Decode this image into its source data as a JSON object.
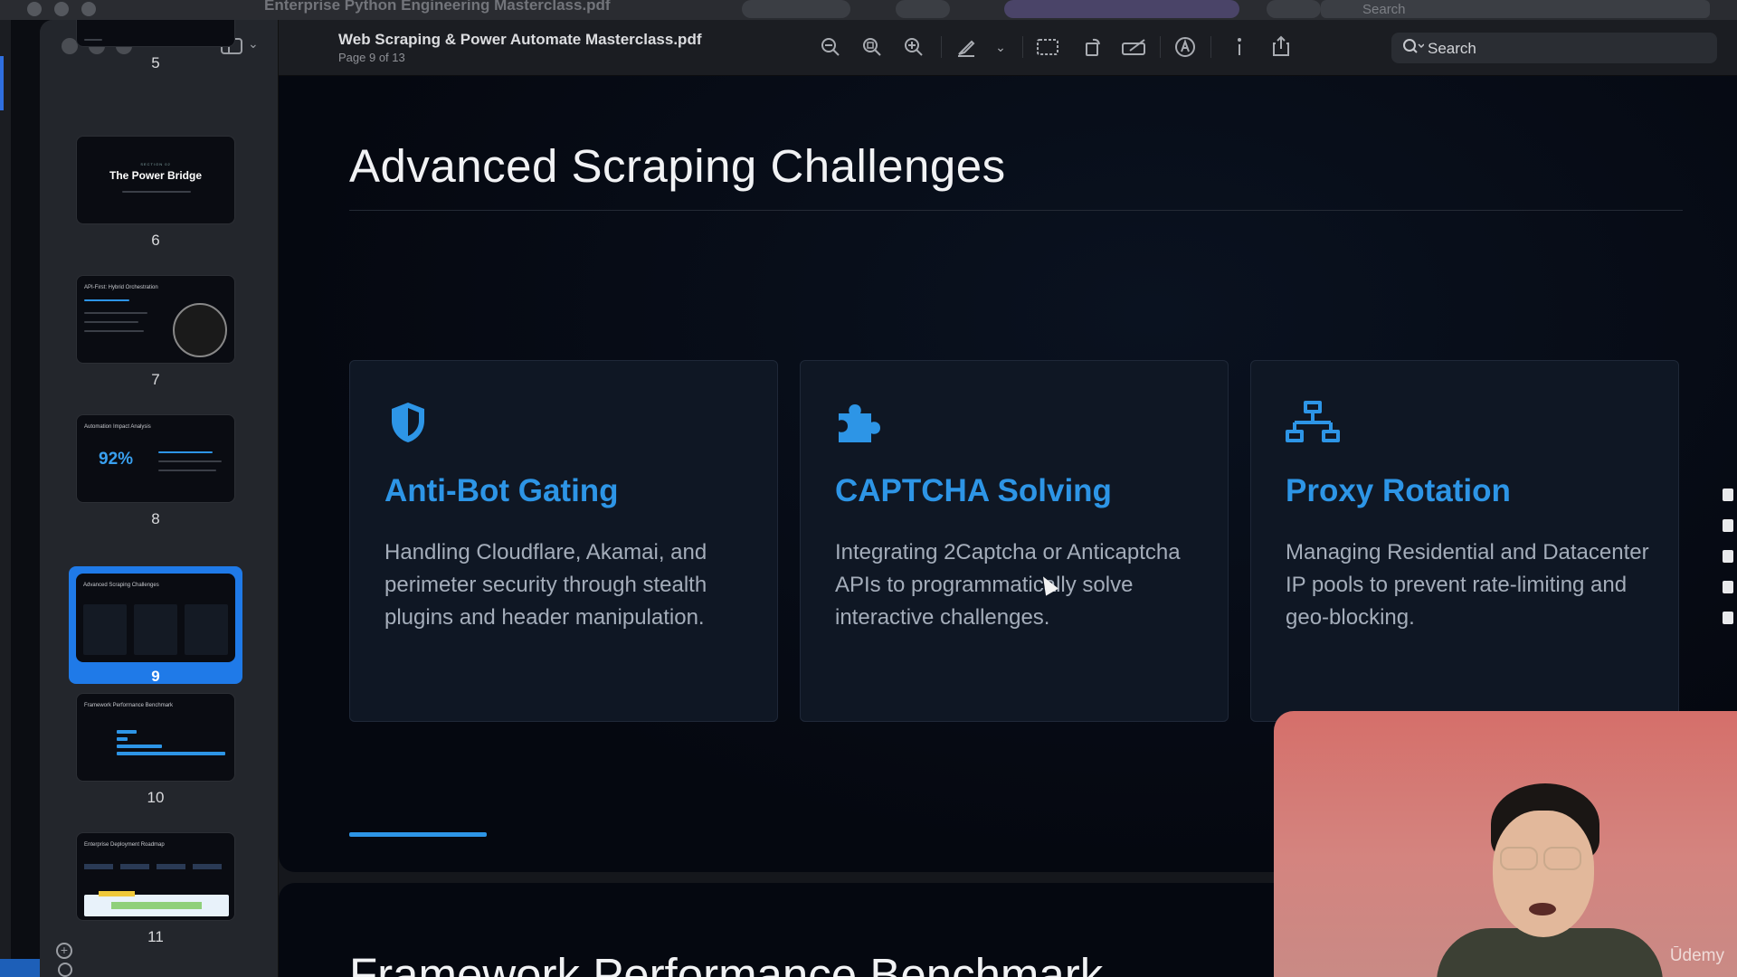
{
  "background_window": {
    "title": "Enterprise Python Engineering Masterclass.pdf",
    "search_placeholder": "Search"
  },
  "window": {
    "document_title": "Web Scraping & Power Automate Masterclass.pdf",
    "page_indicator": "Page 9 of 13",
    "search_label": "Search"
  },
  "toolbar": {
    "icons": [
      "zoom-out-icon",
      "zoom-fit-icon",
      "zoom-in-icon",
      "highlighter-icon",
      "chevron-down-icon",
      "image-select-icon",
      "rotate-icon",
      "markup-icon",
      "accessibility-icon",
      "info-icon",
      "share-icon",
      "search-icon"
    ]
  },
  "sidebar": {
    "thumbnails": [
      {
        "page": "5"
      },
      {
        "page": "6",
        "title": "The Power Bridge",
        "kicker": "SECTION 02"
      },
      {
        "page": "7",
        "title": "API-First: Hybrid Orchestration"
      },
      {
        "page": "8",
        "title": "Automation Impact Analysis",
        "stat": "92%"
      },
      {
        "page": "9",
        "title": "Advanced Scraping Challenges",
        "selected": true
      },
      {
        "page": "10",
        "title": "Framework Performance Benchmark"
      },
      {
        "page": "11",
        "title": "Enterprise Deployment Roadmap"
      }
    ]
  },
  "slide": {
    "title": "Advanced Scraping Challenges",
    "cards": [
      {
        "icon": "shield-icon",
        "title": "Anti-Bot Gating",
        "body": "Handling Cloudflare, Akamai, and perimeter security through stealth plugins and header manipulation."
      },
      {
        "icon": "puzzle-icon",
        "title": "CAPTCHA Solving",
        "body": "Integrating 2Captcha or Anticaptcha APIs to programmatically solve interactive challenges."
      },
      {
        "icon": "network-icon",
        "title": "Proxy Rotation",
        "body": "Managing Residential and Datacenter IP pools to prevent rate-limiting and geo-blocking."
      }
    ]
  },
  "next_slide": {
    "title_partial": "Framework Performance Benchmark"
  },
  "webcam": {
    "brand": "Ūdemy"
  },
  "colors": {
    "accent": "#2d95e6",
    "selection": "#1f7ae8",
    "card_bg": "#0f1724"
  }
}
